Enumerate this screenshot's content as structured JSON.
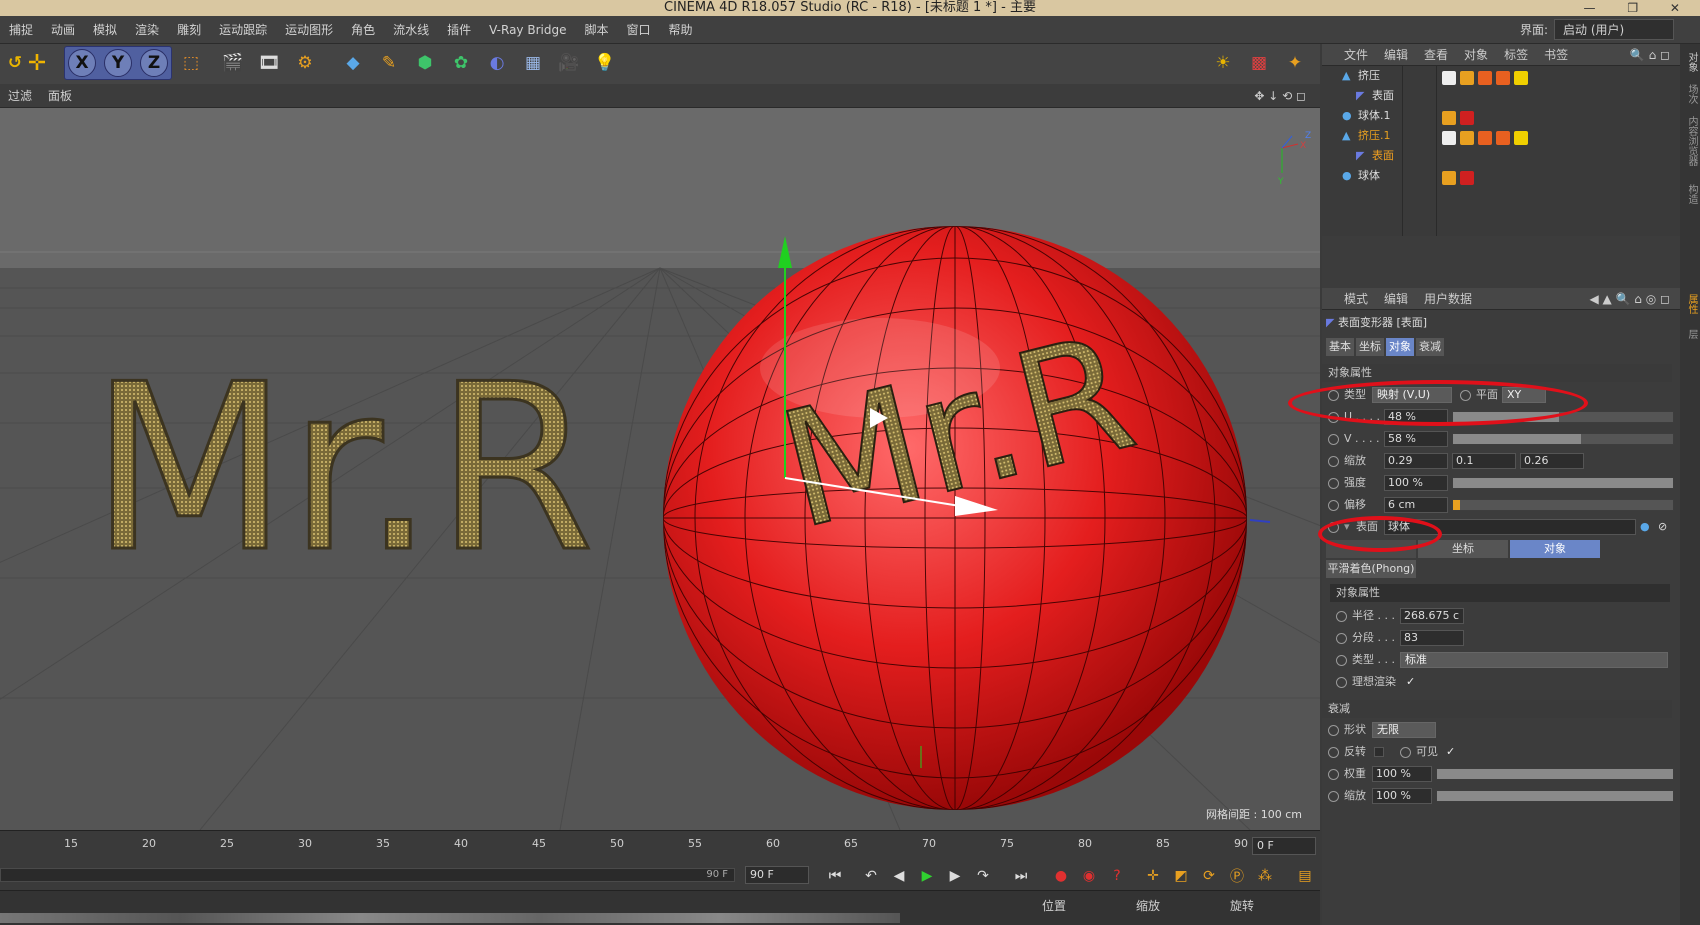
{
  "window": {
    "title": "CINEMA 4D R18.057 Studio (RC - R18) - [未标题 1 *] - 主要",
    "controls": "— ❐ ✕"
  },
  "menu": {
    "items": [
      "捕捉",
      "动画",
      "模拟",
      "渲染",
      "雕刻",
      "运动跟踪",
      "运动图形",
      "角色",
      "流水线",
      "插件",
      "V-Ray Bridge",
      "脚本",
      "窗口",
      "帮助"
    ],
    "interface_label": "界面:",
    "interface_value": "启动 (用户)"
  },
  "toolbar": {
    "x_label": "X",
    "y_label": "Y",
    "z_label": "Z"
  },
  "viewport": {
    "menu": [
      "过滤",
      "面板"
    ],
    "grid_spacing": "网格间距 : 100 cm",
    "text_3d": "Mr.R",
    "sphere_text": "Mr.R",
    "axis_x": "X",
    "axis_y": "Y",
    "axis_z": "Z"
  },
  "timeline": {
    "ticks": [
      "15",
      "20",
      "25",
      "30",
      "35",
      "40",
      "45",
      "50",
      "55",
      "60",
      "65",
      "70",
      "75",
      "80",
      "85",
      "90"
    ],
    "current_frame": "0 F",
    "track_end": "90 F",
    "end_frame": "90 F"
  },
  "coords": {
    "position": "位置",
    "scale": "缩放",
    "rotation": "旋转"
  },
  "object_manager": {
    "menu": [
      "文件",
      "编辑",
      "查看",
      "对象",
      "标签",
      "书签"
    ],
    "objects": [
      {
        "name": "挤压",
        "indent": 0
      },
      {
        "name": "表面",
        "indent": 1
      },
      {
        "name": "球体.1",
        "indent": 0
      },
      {
        "name": "挤压.1",
        "indent": 0
      },
      {
        "name": "表面",
        "indent": 1
      },
      {
        "name": "球体",
        "indent": 0
      }
    ]
  },
  "attributes": {
    "menu": [
      "模式",
      "编辑",
      "用户数据"
    ],
    "title": "表面变形器 [表面]",
    "tabs": [
      "基本",
      "坐标",
      "对象",
      "衰减"
    ],
    "section_object": "对象属性",
    "type_label": "类型",
    "type_value": "映射 (V,U)",
    "plane_label": "平面",
    "plane_value": "XY",
    "u_label": "U . . . .",
    "u_value": "48 %",
    "u_fill": 0.48,
    "v_label": "V . . . .",
    "v_value": "58 %",
    "v_fill": 0.58,
    "scale_label": "缩放",
    "scale_x": "0.29",
    "scale_y": "0.1",
    "scale_z": "0.26",
    "strength_label": "强度",
    "strength_value": "100 %",
    "strength_fill": 1.0,
    "offset_label": "偏移",
    "offset_value": "6 cm",
    "offset_fill": 0.03,
    "surface_label": "表面",
    "surface_value": "球体",
    "subtabs": [
      "坐标",
      "对象"
    ],
    "phong": "平滑着色(Phong)",
    "section_sub": "对象属性",
    "radius_label": "半径 . . .",
    "radius_value": "268.675 c",
    "segments_label": "分段 . . .",
    "segments_value": "83",
    "sphere_type_label": "类型 . . .",
    "sphere_type_value": "标准",
    "ideal_label": "理想渲染",
    "ideal_check": "✓",
    "section_falloff": "衰减",
    "shape_label": "形状",
    "shape_value": "无限",
    "invert_label": "反转",
    "visible_label": "可见",
    "visible_check": "✓",
    "weight_label": "权重",
    "weight_value": "100 %",
    "weight_fill": 1.0,
    "fscale_label": "缩放",
    "fscale_value": "100 %",
    "fscale_fill": 1.0
  },
  "side_tabs": [
    "对象",
    "场次",
    "内容浏览器",
    "构造",
    "属性",
    "层"
  ]
}
